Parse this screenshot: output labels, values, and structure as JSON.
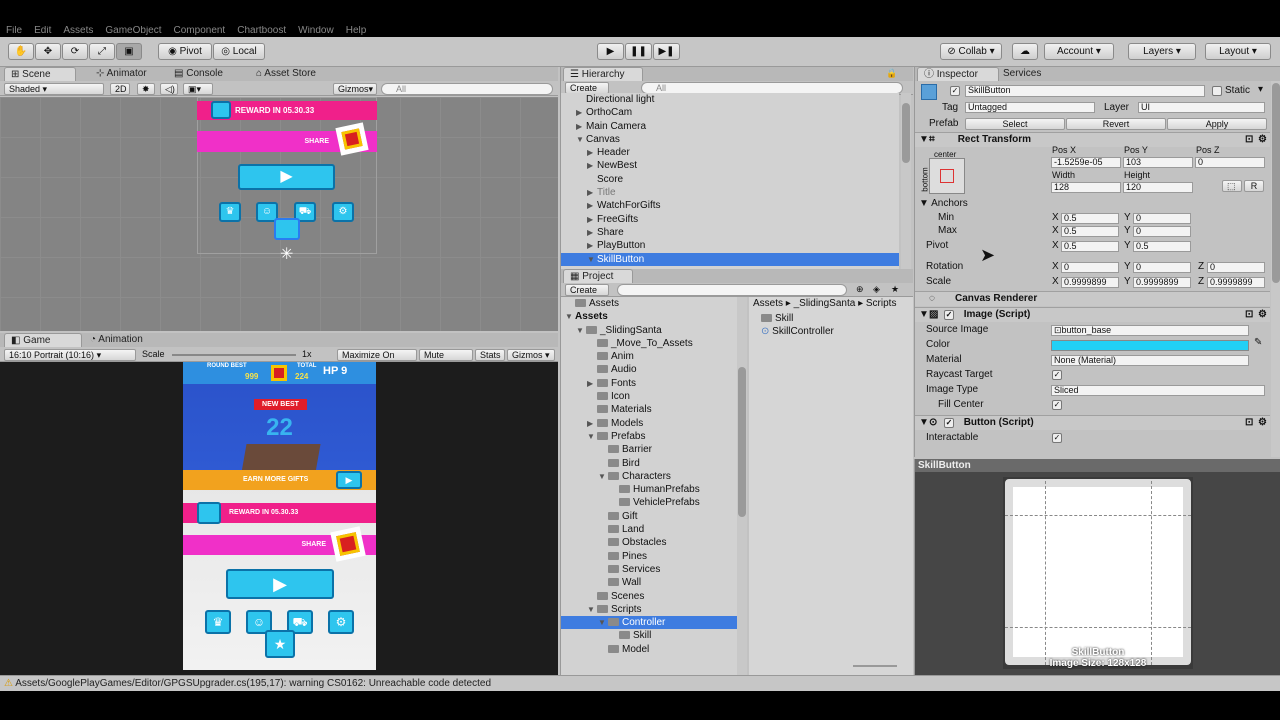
{
  "menu": [
    "File",
    "Edit",
    "Assets",
    "GameObject",
    "Component",
    "Chartboost",
    "Window",
    "Help"
  ],
  "toolbar": {
    "pivot": "Pivot",
    "local": "Local",
    "collab": "Collab",
    "account": "Account",
    "layers": "Layers",
    "layout": "Layout"
  },
  "scene": {
    "tab_scene": "Scene",
    "tab_animator": "Animator",
    "tab_console": "Console",
    "tab_store": "Asset Store",
    "shaded": "Shaded",
    "mode2d": "2D",
    "gizmos": "Gizmos",
    "search": "All",
    "reward": "REWARD IN 05.30.33",
    "share": "SHARE"
  },
  "game": {
    "tab_game": "Game",
    "tab_animation": "Animation",
    "aspect": "16:10 Portrait (10:16)",
    "scale": "Scale",
    "scale_val": "1x",
    "maximize": "Maximize On Play",
    "mute": "Mute Audio",
    "stats": "Stats",
    "gizmos": "Gizmos",
    "round_best": "ROUND BEST",
    "total": "TOTAL",
    "best_val": "999",
    "total_val": "224",
    "hp": "HP",
    "hp_val": "9",
    "new_best": "NEW BEST",
    "score": "22",
    "earn": "EARN MORE GIFTS",
    "reward": "REWARD IN 05.30.33",
    "share": "SHARE"
  },
  "hierarchy": {
    "tab": "Hierarchy",
    "create": "Create",
    "search": "All",
    "items": [
      {
        "label": "Directional light",
        "indent": 1,
        "tri": ""
      },
      {
        "label": "OrthoCam",
        "indent": 1,
        "tri": "▶"
      },
      {
        "label": "Main Camera",
        "indent": 1,
        "tri": "▶"
      },
      {
        "label": "Canvas",
        "indent": 1,
        "tri": "▼"
      },
      {
        "label": "Header",
        "indent": 2,
        "tri": "▶"
      },
      {
        "label": "NewBest",
        "indent": 2,
        "tri": "▶"
      },
      {
        "label": "Score",
        "indent": 2,
        "tri": ""
      },
      {
        "label": "Title",
        "indent": 2,
        "tri": "▶",
        "dim": true
      },
      {
        "label": "WatchForGifts",
        "indent": 2,
        "tri": "▶"
      },
      {
        "label": "FreeGifts",
        "indent": 2,
        "tri": "▶"
      },
      {
        "label": "Share",
        "indent": 2,
        "tri": "▶"
      },
      {
        "label": "PlayButton",
        "indent": 2,
        "tri": "▶"
      },
      {
        "label": "SkillButton",
        "indent": 2,
        "tri": "▼",
        "selected": true
      }
    ]
  },
  "project": {
    "tab": "Project",
    "create": "Create",
    "breadcrumb": [
      "Assets",
      "_SlidingSanta",
      "Scripts"
    ],
    "tree": [
      {
        "label": "Assets",
        "indent": 0,
        "tri": "",
        "folder": true
      },
      {
        "label": "Assets",
        "indent": 0,
        "tri": "▼",
        "bold": true
      },
      {
        "label": "_SlidingSanta",
        "indent": 1,
        "tri": "▼",
        "folder": true
      },
      {
        "label": "_Move_To_Assets",
        "indent": 2,
        "tri": "",
        "folder": true
      },
      {
        "label": "Anim",
        "indent": 2,
        "tri": "",
        "folder": true
      },
      {
        "label": "Audio",
        "indent": 2,
        "tri": "",
        "folder": true
      },
      {
        "label": "Fonts",
        "indent": 2,
        "tri": "▶",
        "folder": true
      },
      {
        "label": "Icon",
        "indent": 2,
        "tri": "",
        "folder": true
      },
      {
        "label": "Materials",
        "indent": 2,
        "tri": "",
        "folder": true
      },
      {
        "label": "Models",
        "indent": 2,
        "tri": "▶",
        "folder": true
      },
      {
        "label": "Prefabs",
        "indent": 2,
        "tri": "▼",
        "folder": true
      },
      {
        "label": "Barrier",
        "indent": 3,
        "tri": "",
        "folder": true
      },
      {
        "label": "Bird",
        "indent": 3,
        "tri": "",
        "folder": true
      },
      {
        "label": "Characters",
        "indent": 3,
        "tri": "▼",
        "folder": true
      },
      {
        "label": "HumanPrefabs",
        "indent": 4,
        "tri": "",
        "folder": true
      },
      {
        "label": "VehiclePrefabs",
        "indent": 4,
        "tri": "",
        "folder": true
      },
      {
        "label": "Gift",
        "indent": 3,
        "tri": "",
        "folder": true
      },
      {
        "label": "Land",
        "indent": 3,
        "tri": "",
        "folder": true
      },
      {
        "label": "Obstacles",
        "indent": 3,
        "tri": "",
        "folder": true
      },
      {
        "label": "Pines",
        "indent": 3,
        "tri": "",
        "folder": true
      },
      {
        "label": "Services",
        "indent": 3,
        "tri": "",
        "folder": true
      },
      {
        "label": "Wall",
        "indent": 3,
        "tri": "",
        "folder": true
      },
      {
        "label": "Scenes",
        "indent": 2,
        "tri": "",
        "folder": true
      },
      {
        "label": "Scripts",
        "indent": 2,
        "tri": "▼",
        "folder": true
      },
      {
        "label": "Controller",
        "indent": 3,
        "tri": "▼",
        "folder": true,
        "selected": true
      },
      {
        "label": "Skill",
        "indent": 4,
        "tri": "",
        "folder": true
      },
      {
        "label": "Model",
        "indent": 3,
        "tri": "",
        "folder": true
      }
    ],
    "files": [
      {
        "label": "Skill",
        "kind": "folder"
      },
      {
        "label": "SkillController",
        "kind": "script"
      }
    ]
  },
  "inspector": {
    "tab": "Inspector",
    "tab_services": "Services",
    "name": "SkillButton",
    "static": "Static",
    "tag_label": "Tag",
    "tag": "Untagged",
    "layer_label": "Layer",
    "layer": "UI",
    "prefab_label": "Prefab",
    "select": "Select",
    "revert": "Revert",
    "apply": "Apply",
    "rect_title": "Rect Transform",
    "anchor_h": "center",
    "anchor_v": "bottom",
    "posx_label": "Pos X",
    "posy_label": "Pos Y",
    "posz_label": "Pos Z",
    "posx": "-1.5259e-05",
    "posy": "103",
    "posz": "0",
    "width_label": "Width",
    "height_label": "Height",
    "width": "128",
    "height": "120",
    "anchors": "Anchors",
    "min": "Min",
    "max": "Max",
    "pivot": "Pivot",
    "min_x": "0.5",
    "min_y": "0",
    "max_x": "0.5",
    "max_y": "0",
    "pivot_x": "0.5",
    "pivot_y": "0.5",
    "rotation": "Rotation",
    "rot_x": "0",
    "rot_y": "0",
    "rot_z": "0",
    "scale": "Scale",
    "scale_x": "0.9999899",
    "scale_y": "0.9999899",
    "scale_z": "0.9999899",
    "canvas_renderer": "Canvas Renderer",
    "image_script": "Image (Script)",
    "source_image_label": "Source Image",
    "source_image": "button_base",
    "color_label": "Color",
    "color": "#22d0f5",
    "material_label": "Material",
    "material": "None (Material)",
    "raycast": "Raycast Target",
    "image_type_label": "Image Type",
    "image_type": "Sliced",
    "fill_center": "Fill Center",
    "button_script": "Button (Script)",
    "interactable": "Interactable",
    "preview_title": "SkillButton",
    "preview_name": "SkillButton",
    "preview_size": "Image Size: 128x128"
  },
  "status": "Assets/GooglePlayGames/Editor/GPGSUpgrader.cs(195,17): warning CS0162: Unreachable code detected"
}
